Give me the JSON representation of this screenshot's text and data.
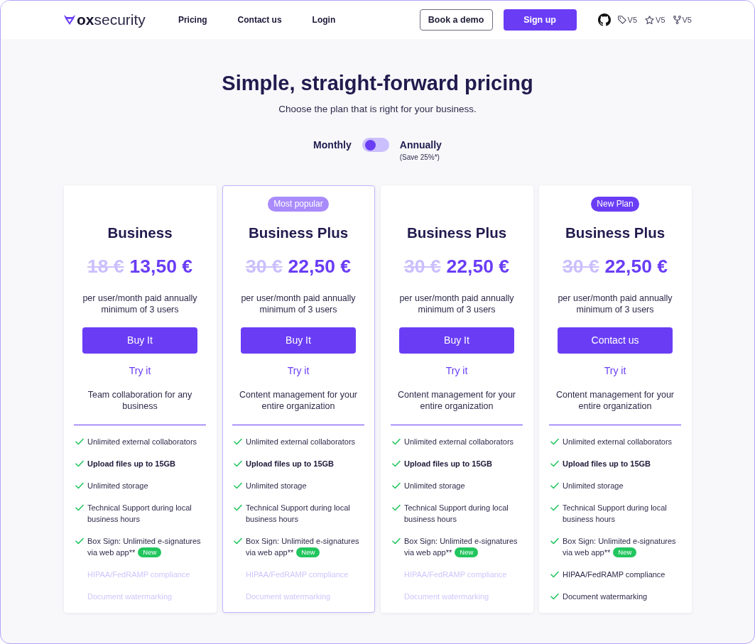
{
  "header": {
    "logo": "**ox**security",
    "nav": [
      "Pricing",
      "Contact us",
      "Login"
    ],
    "buttons": [
      {
        "label": "Book a demo",
        "kind": "outline"
      },
      {
        "label": "Sign up",
        "kind": "primary"
      }
    ],
    "repo_stats": [
      {
        "kind": "tag",
        "value": "V5"
      },
      {
        "kind": "star",
        "value": "V5"
      },
      {
        "kind": "fork",
        "value": "V5"
      }
    ]
  },
  "hero": {
    "title": "Simple, straight-forward pricing",
    "subtitle": "Choose the plan that is right for your business."
  },
  "billing_toggle": {
    "left_label": "Monthly",
    "right_label": "Annually",
    "note": "(Save 25%*)",
    "on": false
  },
  "plans": [
    {
      "name": "Business",
      "featured": false,
      "old_price": "18 €",
      "price": "13,50 €",
      "billing": "per user/month paid annually minimum of 3 users",
      "button": "Buy It",
      "link": "Try it",
      "description": "Team collaboration for any business",
      "features": [
        {
          "text": "Unlimited external collaborators",
          "included": true,
          "bold": false
        },
        {
          "text": "Upload files up to 15GB",
          "included": true,
          "bold": true
        },
        {
          "text": "Unlimited storage",
          "included": true,
          "bold": false
        },
        {
          "text": "Technical Support during local business hours",
          "included": true,
          "bold": false
        },
        {
          "lines": [
            "Box Sign: Unlimited e-signatures",
            "via web app**"
          ],
          "included": true,
          "bold": false,
          "badge": "New"
        },
        {
          "text": "HIPAA/FedRAMP compliance",
          "included": false,
          "bold": false
        },
        {
          "text": "Document watermarking",
          "included": false,
          "bold": false
        }
      ]
    },
    {
      "name": "Business Plus",
      "featured": true,
      "badge": {
        "text": "Most popular",
        "color": "#a98bfb"
      },
      "old_price": "30 €",
      "price": "22,50 €",
      "billing": "per user/month paid annually minimum of 3 users",
      "button": "Buy It",
      "link": "Try it",
      "description": "Content management for your entire organization",
      "features": [
        {
          "text": "Unlimited external collaborators",
          "included": true,
          "bold": false
        },
        {
          "text": "Upload files up to 15GB",
          "included": true,
          "bold": true
        },
        {
          "text": "Unlimited storage",
          "included": true,
          "bold": false
        },
        {
          "text": "Technical Support during local business hours",
          "included": true,
          "bold": false
        },
        {
          "lines": [
            "Box Sign: Unlimited e-signatures",
            "via web app**"
          ],
          "included": true,
          "bold": false,
          "badge": "New"
        },
        {
          "text": "HIPAA/FedRAMP compliance",
          "included": false,
          "bold": false
        },
        {
          "text": "Document watermarking",
          "included": false,
          "bold": false
        }
      ]
    },
    {
      "name": "Business Plus",
      "featured": false,
      "old_price": "30 €",
      "price": "22,50 €",
      "billing": "per user/month paid annually minimum of 3 users",
      "button": "Buy It",
      "link": "Try it",
      "description": "Content management for your entire organization",
      "features": [
        {
          "text": "Unlimited external collaborators",
          "included": true,
          "bold": false
        },
        {
          "text": "Upload files up to 15GB",
          "included": true,
          "bold": true
        },
        {
          "text": "Unlimited storage",
          "included": true,
          "bold": false
        },
        {
          "text": "Technical Support during local business hours",
          "included": true,
          "bold": false
        },
        {
          "lines": [
            "Box Sign: Unlimited e-signatures",
            "via web app**"
          ],
          "included": true,
          "bold": false,
          "badge": "New"
        },
        {
          "text": "HIPAA/FedRAMP compliance",
          "included": false,
          "bold": false
        },
        {
          "text": "Document watermarking",
          "included": false,
          "bold": false
        }
      ]
    },
    {
      "name": "Business Plus",
      "featured": false,
      "badge": {
        "text": "New Plan",
        "color": "#6a3df5"
      },
      "old_price": "30 €",
      "price": "22,50 €",
      "billing": "per user/month paid annually minimum of 3 users",
      "button": "Contact us",
      "link": "Try it",
      "description": "Content management for your entire organization",
      "features": [
        {
          "text": "Unlimited external collaborators",
          "included": true,
          "bold": false
        },
        {
          "text": "Upload files up to 15GB",
          "included": true,
          "bold": true
        },
        {
          "text": "Unlimited storage",
          "included": true,
          "bold": false
        },
        {
          "text": "Technical Support during local business hours",
          "included": true,
          "bold": false
        },
        {
          "lines": [
            "Box Sign: Unlimited e-signatures",
            "via web app**"
          ],
          "included": true,
          "bold": false,
          "badge": "New"
        },
        {
          "text": "HIPAA/FedRAMP compliance",
          "included": true,
          "bold": false
        },
        {
          "text": "Document watermarking",
          "included": true,
          "bold": false
        }
      ]
    }
  ]
}
